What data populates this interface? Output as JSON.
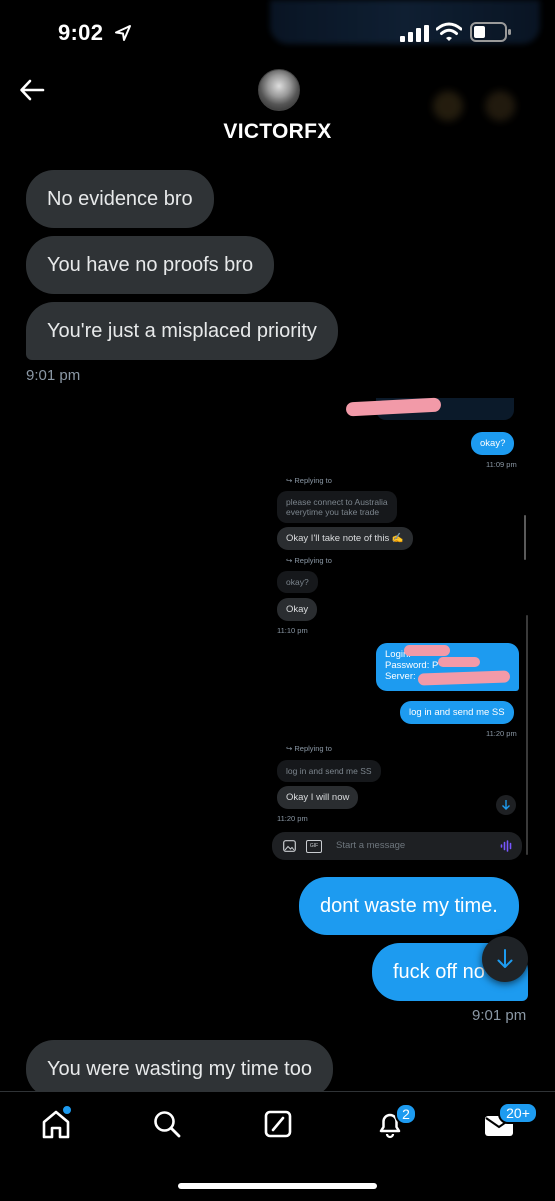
{
  "status_bar": {
    "time": "9:02"
  },
  "header": {
    "name": "VICTORFX"
  },
  "messages": {
    "m1": "No evidence bro",
    "m2": "You have no proofs bro",
    "m3": "You're just a misplaced priority",
    "t1": "9:01 pm",
    "m4": "dont waste my time.",
    "m5": "fuck off no",
    "t2": "9:01 pm",
    "m6": "You were wasting my time too"
  },
  "embedded": {
    "okay_q": "okay?",
    "t_1109": "11:09 pm",
    "replying_to": "Replying to",
    "reply1_l1": "please connect to Australia",
    "reply1_l2": "everytime you take trade",
    "msg_note": "Okay I'll take note of this ✍️",
    "reply2": "okay?",
    "msg_okay": "Okay",
    "t_1110": "11:10 pm",
    "login": "Login:",
    "password": "Password: P",
    "server": "Server: ",
    "msg_log": "log in and send me SS",
    "t_1120a": "11:20 pm",
    "reply3": "log in and send me SS",
    "msg_will": "Okay I will now",
    "t_1120b": "11:20 pm",
    "compose_placeholder": "Start a message",
    "gif": "GIF"
  },
  "nav": {
    "items": [
      "home-icon",
      "search-icon",
      "grok-icon",
      "bell-icon",
      "mail-icon"
    ],
    "notif_badge": "2",
    "messages_badge": "20+"
  },
  "colors": {
    "accent": "#1d9bf0",
    "incoming_bubble": "#2f3336",
    "background": "#000000"
  }
}
